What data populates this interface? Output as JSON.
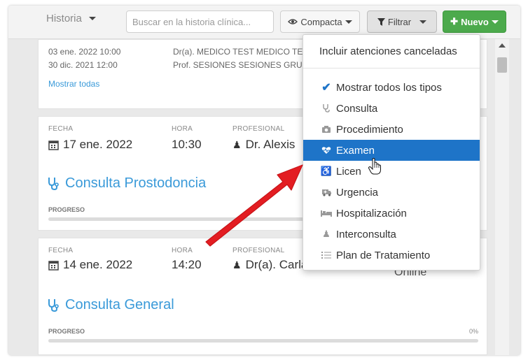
{
  "toolbar": {
    "historia_label": "Historia",
    "search_placeholder": "Buscar en la historia clínica...",
    "compacta_label": "Compacta",
    "filtrar_label": "Filtrar",
    "nuevo_label": "Nuevo"
  },
  "card1": {
    "lines": [
      {
        "date": "03 ene. 2022 10:00",
        "prof": "Dr(a). MEDICO TEST MEDICO TE"
      },
      {
        "date": "30 dic. 2021 12:00",
        "prof": "Prof. SESIONES SESIONES GRUP"
      }
    ],
    "mostrar": "Mostrar todas"
  },
  "labels": {
    "fecha": "FECHA",
    "hora": "HORA",
    "profesional": "PROFESIONAL",
    "progreso": "PROGRESO"
  },
  "card2": {
    "date": "17 ene. 2022",
    "time": "10:30",
    "prof": "Dr. Alexis",
    "title": "Consulta Prostodoncia"
  },
  "card3": {
    "date": "14 ene. 2022",
    "time": "14:20",
    "prof": "Dr(a). Carla",
    "title": "Consulta General",
    "extra": "Online",
    "progress_pct": "0%"
  },
  "dropdown": {
    "header": "Incluir atenciones canceladas",
    "items": [
      {
        "label": "Mostrar todos los tipos",
        "icon": "checkmark-icon"
      },
      {
        "label": "Consulta",
        "icon": "stethoscope-icon"
      },
      {
        "label": "Procedimiento",
        "icon": "camera-icon"
      },
      {
        "label": "Examen",
        "icon": "heart-pulse-icon"
      },
      {
        "label": "Licen",
        "icon": "wheelchair-icon"
      },
      {
        "label": "Urgencia",
        "icon": "ambulance-icon"
      },
      {
        "label": "Hospitalización",
        "icon": "bed-icon"
      },
      {
        "label": "Interconsulta",
        "icon": "doctor-icon"
      },
      {
        "label": "Plan de Tratamiento",
        "icon": "list-icon"
      }
    ]
  },
  "colors": {
    "accent": "#3a9ad9",
    "active": "#1e74c8",
    "success": "#4caa4c",
    "arrow": "#e31d22"
  }
}
